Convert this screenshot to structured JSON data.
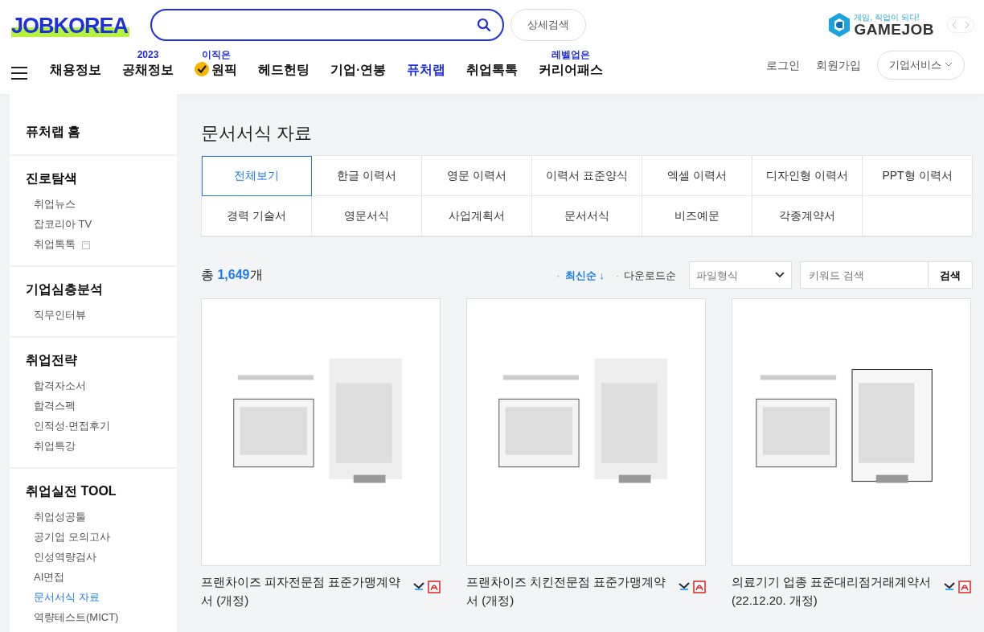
{
  "header": {
    "logo": "JOBKOREA",
    "detail_search": "상세검색",
    "gamejob": {
      "tagline": "게임, 직업이 되다!",
      "name": "GAMEJOB"
    },
    "nav": [
      {
        "label": "채용정보",
        "selected": false
      },
      {
        "label": "공채정보",
        "badge": "2023",
        "selected": false
      },
      {
        "label": "원픽",
        "badge": "이직은",
        "kind": "check",
        "selected": false
      },
      {
        "label": "헤드헌팅",
        "selected": false
      },
      {
        "label": "기업·연봉",
        "selected": false
      },
      {
        "label": "퓨처랩",
        "selected": true
      },
      {
        "label": "취업톡톡",
        "selected": false
      },
      {
        "label": "커리어패스",
        "badge": "레벨업은",
        "selected": false
      }
    ],
    "user_links": [
      "로그인",
      "회원가입"
    ],
    "business_button": "기업서비스"
  },
  "sidebar": [
    {
      "title": "퓨처랩 홈"
    },
    {
      "title": "진로탐색",
      "items": [
        {
          "label": "취업뉴스",
          "selected": false
        },
        {
          "label": "잡코리아 TV",
          "selected": false
        },
        {
          "label": "취업톡톡",
          "selected": false,
          "new_window": true
        }
      ]
    },
    {
      "title": "기업심층분석",
      "items": [
        {
          "label": "직무인터뷰",
          "selected": false
        }
      ]
    },
    {
      "title": "취업전략",
      "items": [
        {
          "label": "합격자소서",
          "selected": false
        },
        {
          "label": "합격스펙",
          "selected": false
        },
        {
          "label": "인적성·면접후기",
          "selected": false
        },
        {
          "label": "취업특강",
          "selected": false
        }
      ]
    },
    {
      "title": "취업실전 TOOL",
      "items": [
        {
          "label": "취업성공툴",
          "selected": false
        },
        {
          "label": "공기업 모의고사",
          "selected": false
        },
        {
          "label": "인성역량검사",
          "selected": false
        },
        {
          "label": "AI면접",
          "selected": false
        },
        {
          "label": "문서서식 자료",
          "selected": true
        },
        {
          "label": "역량테스트(MICT)",
          "selected": false
        }
      ]
    }
  ],
  "page_title": "문서서식 자료",
  "tabs": [
    {
      "label": "전체보기",
      "selected": true
    },
    {
      "label": "한글 이력서",
      "selected": false
    },
    {
      "label": "영문 이력서",
      "selected": false
    },
    {
      "label": "이력서 표준양식",
      "selected": false
    },
    {
      "label": "엑셀 이력서",
      "selected": false
    },
    {
      "label": "디자인형 이력서",
      "selected": false
    },
    {
      "label": "PPT형 이력서",
      "selected": false
    },
    {
      "label": "경력 기술서",
      "selected": false
    },
    {
      "label": "영문서식",
      "selected": false
    },
    {
      "label": "사업계획서",
      "selected": false
    },
    {
      "label": "문서서식",
      "selected": false
    },
    {
      "label": "비즈예문",
      "selected": false
    },
    {
      "label": "각종계약서",
      "selected": false
    }
  ],
  "total": {
    "prefix": "총",
    "count": "1,649",
    "suffix": "개"
  },
  "sort": [
    {
      "bullet": "·",
      "label": "최신순 ↓",
      "selected": true
    },
    {
      "bullet": "·",
      "label": "다운로드순",
      "selected": false
    }
  ],
  "file_type": "파일형식",
  "keyword": {
    "placeholder": "키워드 검색"
  },
  "search_button": "검색",
  "documents": [
    {
      "title": "프랜차이즈 피자전문점 표준가맹계약서 (개정)",
      "kind": "picture"
    },
    {
      "title": "프랜차이즈 치킨전문점 표준가맹계약서 (개정)",
      "kind": "picture"
    },
    {
      "title": "의료기기 업종 표준대리점거래계약서 (22.12.20. 개정)",
      "kind": "picture"
    }
  ]
}
